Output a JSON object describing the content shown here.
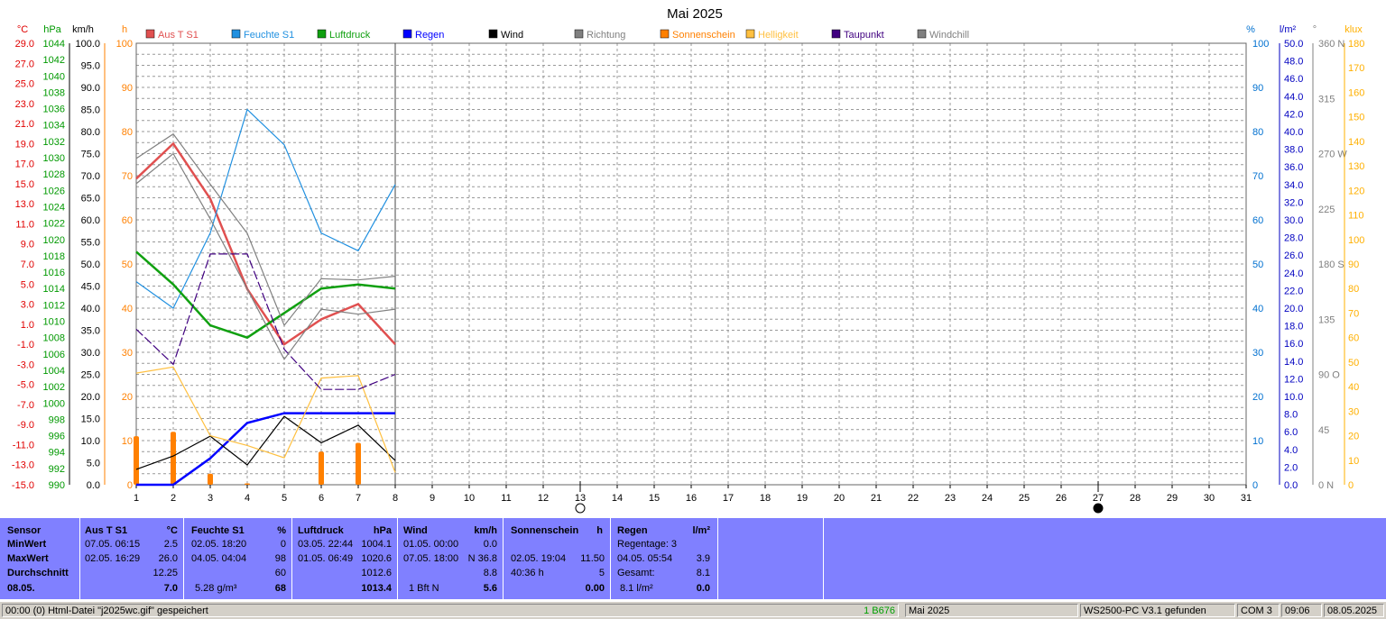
{
  "chart_data": {
    "type": "line",
    "title": "Mai 2025",
    "x": [
      1,
      2,
      3,
      4,
      5,
      6,
      7,
      8
    ],
    "x_ticks": [
      "1",
      "2",
      "3",
      "4",
      "5",
      "6",
      "7",
      "8",
      "9",
      "10",
      "11",
      "12",
      "13",
      "14",
      "15",
      "16",
      "17",
      "18",
      "19",
      "20",
      "21",
      "22",
      "23",
      "24",
      "25",
      "26",
      "27",
      "28",
      "29",
      "30",
      "31"
    ],
    "xlim": [
      1,
      31
    ],
    "grid": true,
    "axes": {
      "temp": {
        "unit": "°C",
        "color": "#e00000",
        "ticks": [
          "29.0",
          "27.0",
          "25.0",
          "23.0",
          "21.0",
          "19.0",
          "17.0",
          "15.0",
          "13.0",
          "11.0",
          "9.0",
          "7.0",
          "5.0",
          "3.0",
          "1.0",
          "-1.0",
          "-3.0",
          "-5.0",
          "-7.0",
          "-9.0",
          "-11.0",
          "-13.0",
          "-15.0"
        ]
      },
      "pressure": {
        "unit": "hPa",
        "color": "#009900",
        "ticks": [
          "1044",
          "1042",
          "1040",
          "1038",
          "1036",
          "1034",
          "1032",
          "1030",
          "1028",
          "1026",
          "1024",
          "1022",
          "1020",
          "1018",
          "1016",
          "1014",
          "1012",
          "1010",
          "1008",
          "1006",
          "1004",
          "1002",
          "1000",
          "998",
          "996",
          "994",
          "992",
          "990"
        ]
      },
      "wind": {
        "unit": "km/h",
        "color": "#000000",
        "ticks": [
          "100.0",
          "95.0",
          "90.0",
          "85.0",
          "80.0",
          "75.0",
          "70.0",
          "65.0",
          "60.0",
          "55.0",
          "50.0",
          "45.0",
          "40.0",
          "35.0",
          "30.0",
          "25.0",
          "20.0",
          "15.0",
          "10.0",
          "5.0",
          "0.0"
        ]
      },
      "hours": {
        "unit": "h",
        "color": "#ff8000",
        "ticks": [
          "100",
          "90",
          "80",
          "70",
          "60",
          "50",
          "40",
          "30",
          "20",
          "10",
          "0"
        ]
      },
      "humidity": {
        "unit": "%",
        "color": "#0070d0",
        "ticks": [
          "100",
          "90",
          "80",
          "70",
          "60",
          "50",
          "40",
          "30",
          "20",
          "10",
          "0"
        ]
      },
      "rain": {
        "unit": "l/m²",
        "color": "#0000c0",
        "ticks": [
          "50.0",
          "48.0",
          "46.0",
          "44.0",
          "42.0",
          "40.0",
          "38.0",
          "36.0",
          "34.0",
          "32.0",
          "30.0",
          "28.0",
          "26.0",
          "24.0",
          "22.0",
          "20.0",
          "18.0",
          "16.0",
          "14.0",
          "12.0",
          "10.0",
          "8.0",
          "6.0",
          "4.0",
          "2.0",
          "0.0"
        ]
      },
      "direction": {
        "unit": "°",
        "color": "#808080",
        "ticks": [
          "360 N",
          "315",
          "270 W",
          "225",
          "180 S",
          "135",
          "90 O",
          "45",
          "0 N"
        ]
      },
      "lux": {
        "unit": "klux",
        "color": "#ffb000",
        "ticks": [
          "180",
          "170",
          "160",
          "150",
          "140",
          "130",
          "120",
          "110",
          "100",
          "90",
          "80",
          "70",
          "60",
          "50",
          "40",
          "30",
          "20",
          "10",
          "0"
        ]
      }
    },
    "series": [
      {
        "name": "Aus T S1",
        "color": "#e05050",
        "axis": "temp",
        "values": [
          15.5,
          19.0,
          13.5,
          4.5,
          -1.0,
          1.5,
          3.0,
          -1.0
        ]
      },
      {
        "name": "Feuchte S1",
        "color": "#2090e0",
        "axis": "humidity",
        "values": [
          46,
          40,
          57,
          85,
          77,
          57,
          53,
          68
        ]
      },
      {
        "name": "Luftdruck",
        "color": "#10a010",
        "axis": "pressure",
        "values": [
          1018.5,
          1014.5,
          1009.5,
          1008.0,
          1011.0,
          1014.0,
          1014.5,
          1014.0
        ]
      },
      {
        "name": "Regen",
        "color": "#0000ff",
        "axis": "rain",
        "values": [
          0.0,
          0.0,
          3.0,
          7.0,
          8.1,
          8.1,
          8.1,
          8.1
        ]
      },
      {
        "name": "Wind",
        "color": "#000000",
        "axis": "wind",
        "values": [
          3.5,
          6.5,
          11.0,
          4.5,
          15.5,
          9.5,
          13.5,
          5.5
        ]
      },
      {
        "name": "Richtung",
        "color": "#808080",
        "axis": "direction",
        "values": [
          266,
          286,
          245,
          205,
          130,
          168,
          167,
          170
        ]
      },
      {
        "name": "Sonnenschein",
        "color": "#ff8000",
        "axis": "hours",
        "type": "bar",
        "values": [
          11.0,
          12.0,
          2.5,
          0.3,
          0,
          7.5,
          9.5,
          0
        ]
      },
      {
        "name": "Helligkeit",
        "color": "#ffc040",
        "axis": "lux",
        "values": [
          45.5,
          48.0,
          20.0,
          16.0,
          11.0,
          43.5,
          44.5,
          5.0
        ]
      },
      {
        "name": "Taupunkt",
        "color": "#400080",
        "axis": "temp",
        "values": [
          0.5,
          -3.0,
          8.0,
          8.0,
          -1.5,
          -5.5,
          -5.5,
          -4.0
        ]
      },
      {
        "name": "Windchill",
        "color": "#808080",
        "axis": "temp",
        "values": [
          15.0,
          18.0,
          11.5,
          4.5,
          -2.5,
          2.5,
          2.0,
          2.5
        ]
      }
    ],
    "moon": [
      {
        "day": 13,
        "phase": "full"
      },
      {
        "day": 27,
        "phase": "new"
      }
    ]
  },
  "panel": {
    "sensor": {
      "header": "Sensor",
      "min": "MinWert",
      "max": "MaxWert",
      "avg": "Durchschnitt",
      "date": "08.05."
    },
    "temp": {
      "title": "Aus T S1",
      "unit": "°C",
      "min_time": "07.05.  06:15",
      "min_val": "2.5",
      "max_time": "02.05.  16:29",
      "max_val": "26.0",
      "avg": "12.25",
      "current": "7.0"
    },
    "humidity": {
      "title": "Feuchte S1",
      "unit": "%",
      "min_time": "02.05.  18:20",
      "min_val": "0",
      "max_time": "04.05.  04:04",
      "max_val": "98",
      "avg": "60",
      "abs": "5.28 g/m³",
      "current": "68"
    },
    "pressure": {
      "title": "Luftdruck",
      "unit": "hPa",
      "min_time": "03.05.  22:44",
      "min_val": "1004.1",
      "max_time": "01.05.  06:49",
      "max_val": "1020.6",
      "avg": "1012.6",
      "current": "1013.4"
    },
    "wind": {
      "title": "Wind",
      "unit": "km/h",
      "min_time": "01.05.  00:00",
      "min_val": "0.0",
      "max_time": "07.05.  18:00",
      "max_val": "N 36.8",
      "avg": "8.8",
      "bft": "1 Bft N",
      "current": "5.6"
    },
    "sun": {
      "title": "Sonnenschein",
      "unit": "h",
      "max_time": "02.05.  19:04",
      "max_val": "11.50",
      "total_h": "40:36 h",
      "avg": "5",
      "current": "0.00"
    },
    "rain": {
      "title": "Regen",
      "unit": "l/m²",
      "days": "Regentage: 3",
      "max_time": "04.05.  05:54",
      "max_val": "3.9",
      "total_label": "Gesamt:",
      "total_val": "8.1",
      "current_label": "8.1 l/m²",
      "current": "0.0"
    }
  },
  "status": {
    "msg": "00:00  (0)  Html-Datei  \"j2025wc.gif\"  gespeichert",
    "code": "1 B676",
    "month": "Mai 2025",
    "device": "WS2500-PC V3.1 gefunden",
    "port": "COM 3",
    "time": "09:06",
    "date": "08.05.2025"
  }
}
